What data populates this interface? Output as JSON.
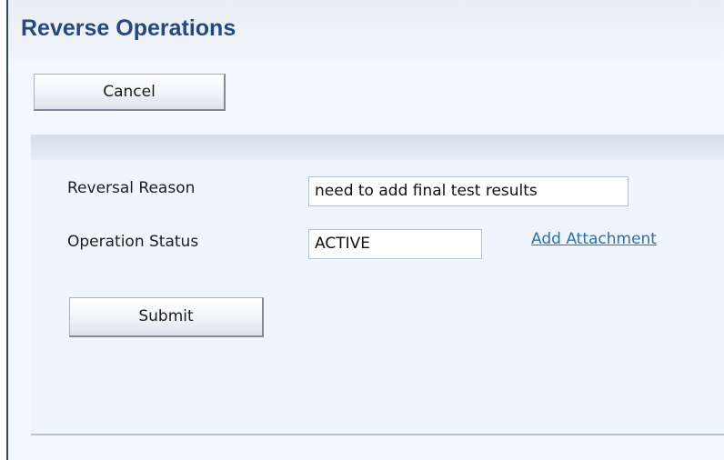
{
  "header": {
    "title": "Reverse Operations"
  },
  "toolbar": {
    "cancel_label": "Cancel"
  },
  "form": {
    "reversal_reason_label": "Reversal Reason",
    "reversal_reason_value": "need to add final test results",
    "operation_status_label": "Operation Status",
    "operation_status_value": "ACTIVE",
    "add_attachment_label": "Add Attachment",
    "submit_label": "Submit"
  },
  "colors": {
    "title": "#24487f",
    "link": "#2b73a5",
    "content_background": "#f2f8fd",
    "section_band": "#d4e0ec"
  }
}
